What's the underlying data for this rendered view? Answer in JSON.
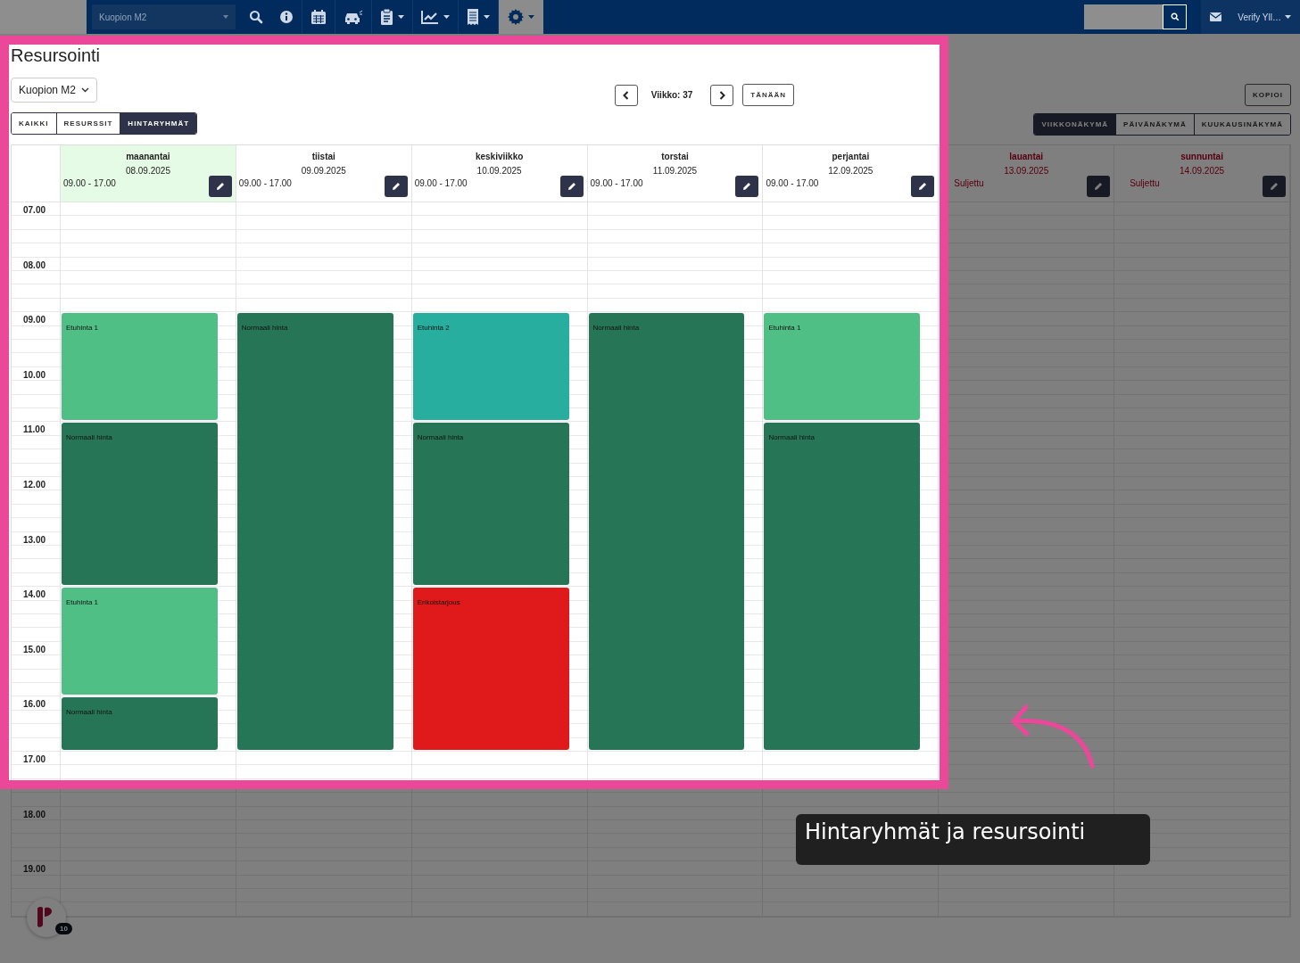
{
  "navbar": {
    "site_select": "Kuopion M2",
    "user_menu": "Verify Yll…",
    "icons": [
      {
        "kind": "search",
        "caret": false,
        "selected": false
      },
      {
        "kind": "info",
        "caret": false,
        "selected": false
      },
      {
        "kind": "calendar",
        "caret": false,
        "selected": false
      },
      {
        "kind": "car",
        "caret": false,
        "selected": false
      },
      {
        "kind": "clipboard",
        "caret": true,
        "selected": false
      },
      {
        "kind": "chart",
        "caret": true,
        "selected": false
      },
      {
        "kind": "receipt",
        "caret": true,
        "selected": false
      },
      {
        "kind": "gear",
        "caret": true,
        "selected": true
      }
    ]
  },
  "page_title": "Resursointi",
  "location_select": "Kuopion M2",
  "filter_tabs": [
    {
      "label": "KAIKKI",
      "selected": false
    },
    {
      "label": "RESURSSIT",
      "selected": false
    },
    {
      "label": "HINTARYHMÄT",
      "selected": true
    }
  ],
  "week_label": "Viikko: 37",
  "today_button": "TÄNÄÄN",
  "copy_button": "KOPIOI",
  "view_tabs": [
    {
      "label": "VIIKKONÄKYMÄ",
      "selected": true
    },
    {
      "label": "PÄIVÄNÄKYMÄ",
      "selected": false
    },
    {
      "label": "KUUKAUSINÄKYMÄ",
      "selected": false
    }
  ],
  "hours": [
    "07.00",
    "08.00",
    "09.00",
    "10.00",
    "11.00",
    "12.00",
    "13.00",
    "14.00",
    "15.00",
    "16.00",
    "17.00",
    "18.00",
    "19.00"
  ],
  "days": [
    {
      "name": "maanantai",
      "date": "08.09.2025",
      "hours": "09.00 - 17.00",
      "today": true,
      "closed": false,
      "events": [
        {
          "kind": "start",
          "label": "Etuhinta 1",
          "color": "#4fbf85"
        },
        {
          "kind": "continued"
        },
        {
          "kind": "start",
          "label": "Normaali hinta",
          "color": "#277557"
        },
        {
          "kind": "continued"
        },
        {
          "kind": "continued"
        },
        {
          "kind": "start",
          "label": "Etuhinta 1",
          "color": "#4fbf85"
        },
        {
          "kind": "continued"
        },
        {
          "kind": "start",
          "label": "Normaali hinta",
          "color": "#277557"
        }
      ]
    },
    {
      "name": "tiistai",
      "date": "09.09.2025",
      "hours": "09.00 - 17.00",
      "today": false,
      "closed": false,
      "events": [
        {
          "kind": "start",
          "label": "Normaali hinta",
          "color": "#277557"
        },
        {
          "kind": "continued"
        },
        {
          "kind": "continued"
        },
        {
          "kind": "continued"
        },
        {
          "kind": "continued"
        },
        {
          "kind": "continued"
        },
        {
          "kind": "continued"
        },
        {
          "kind": "continued"
        }
      ]
    },
    {
      "name": "keskiviikko",
      "date": "10.09.2025",
      "hours": "09.00 - 17.00",
      "today": false,
      "closed": false,
      "events": [
        {
          "kind": "start",
          "label": "Etuhinta 2",
          "color": "#27ae9f"
        },
        {
          "kind": "continued"
        },
        {
          "kind": "start",
          "label": "Normaali hinta",
          "color": "#277557"
        },
        {
          "kind": "continued"
        },
        {
          "kind": "continued"
        },
        {
          "kind": "start",
          "label": "Erikoistarjous",
          "color": "#e01a1a"
        },
        {
          "kind": "continued"
        },
        {
          "kind": "continued"
        }
      ]
    },
    {
      "name": "torstai",
      "date": "11.09.2025",
      "hours": "09.00 - 17.00",
      "today": false,
      "closed": false,
      "events": [
        {
          "kind": "start",
          "label": "Normaali hinta",
          "color": "#277557"
        },
        {
          "kind": "continued"
        },
        {
          "kind": "continued"
        },
        {
          "kind": "continued"
        },
        {
          "kind": "continued"
        },
        {
          "kind": "continued"
        },
        {
          "kind": "continued"
        },
        {
          "kind": "continued"
        }
      ]
    },
    {
      "name": "perjantai",
      "date": "12.09.2025",
      "hours": "09.00 - 17.00",
      "today": false,
      "closed": false,
      "events": [
        {
          "kind": "start",
          "label": "Etuhinta 1",
          "color": "#4fbf85"
        },
        {
          "kind": "continued"
        },
        {
          "kind": "start",
          "label": "Normaali hinta",
          "color": "#277557"
        },
        {
          "kind": "continued"
        },
        {
          "kind": "continued"
        },
        {
          "kind": "continued"
        },
        {
          "kind": "continued"
        },
        {
          "kind": "continued"
        }
      ]
    },
    {
      "name": "lauantai",
      "date": "13.09.2025",
      "hours": "Suljettu",
      "today": false,
      "closed": true
    },
    {
      "name": "sunnuntai",
      "date": "14.09.2025",
      "hours": "Suljettu",
      "today": false,
      "closed": true
    }
  ],
  "chat_badge": "10",
  "tutorial_caption": "Hintaryhmät ja resursointi"
}
